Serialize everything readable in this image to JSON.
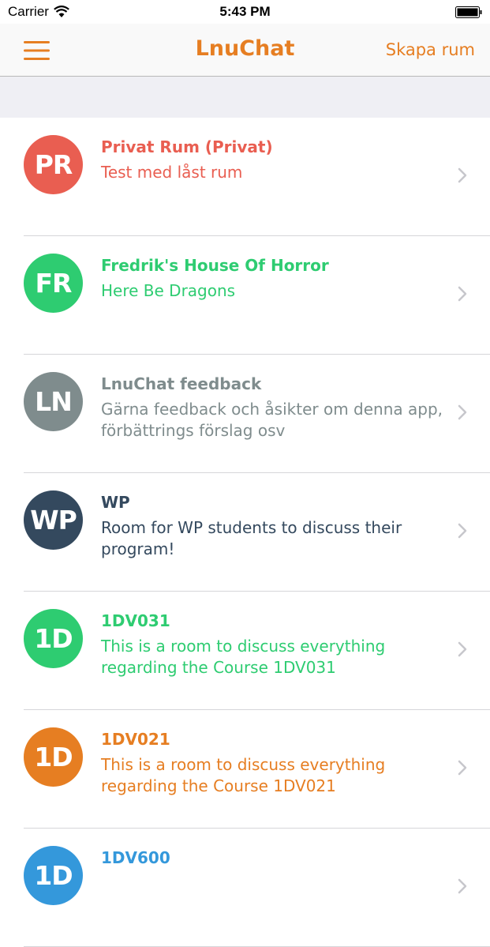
{
  "status_bar": {
    "carrier": "Carrier",
    "time": "5:43 PM"
  },
  "nav": {
    "title": "LnuChat",
    "action_label": "Skapa rum",
    "accent_color": "#e67e22"
  },
  "rooms": [
    {
      "initials": "PR",
      "title": "Privat Rum (Privat)",
      "subtitle": "Test med låst rum",
      "color": "#e95e51"
    },
    {
      "initials": "FR",
      "title": "Fredrik's House Of Horror",
      "subtitle": "Here Be Dragons",
      "color": "#2ecc71"
    },
    {
      "initials": "LN",
      "title": "LnuChat feedback",
      "subtitle": "Gärna feedback och åsikter om denna app, förbättrings förslag osv",
      "color": "#7f8c8d"
    },
    {
      "initials": "WP",
      "title": "WP",
      "subtitle": "Room for WP students to discuss their program!",
      "color": "#34495e"
    },
    {
      "initials": "1D",
      "title": "1DV031",
      "subtitle": "This is a room to discuss everything regarding the Course 1DV031",
      "color": "#2ecc71"
    },
    {
      "initials": "1D",
      "title": "1DV021",
      "subtitle": "This is a room to discuss everything regarding the Course 1DV021",
      "color": "#e67e22"
    },
    {
      "initials": "1D",
      "title": "1DV600",
      "subtitle": "",
      "color": "#3498db"
    }
  ]
}
